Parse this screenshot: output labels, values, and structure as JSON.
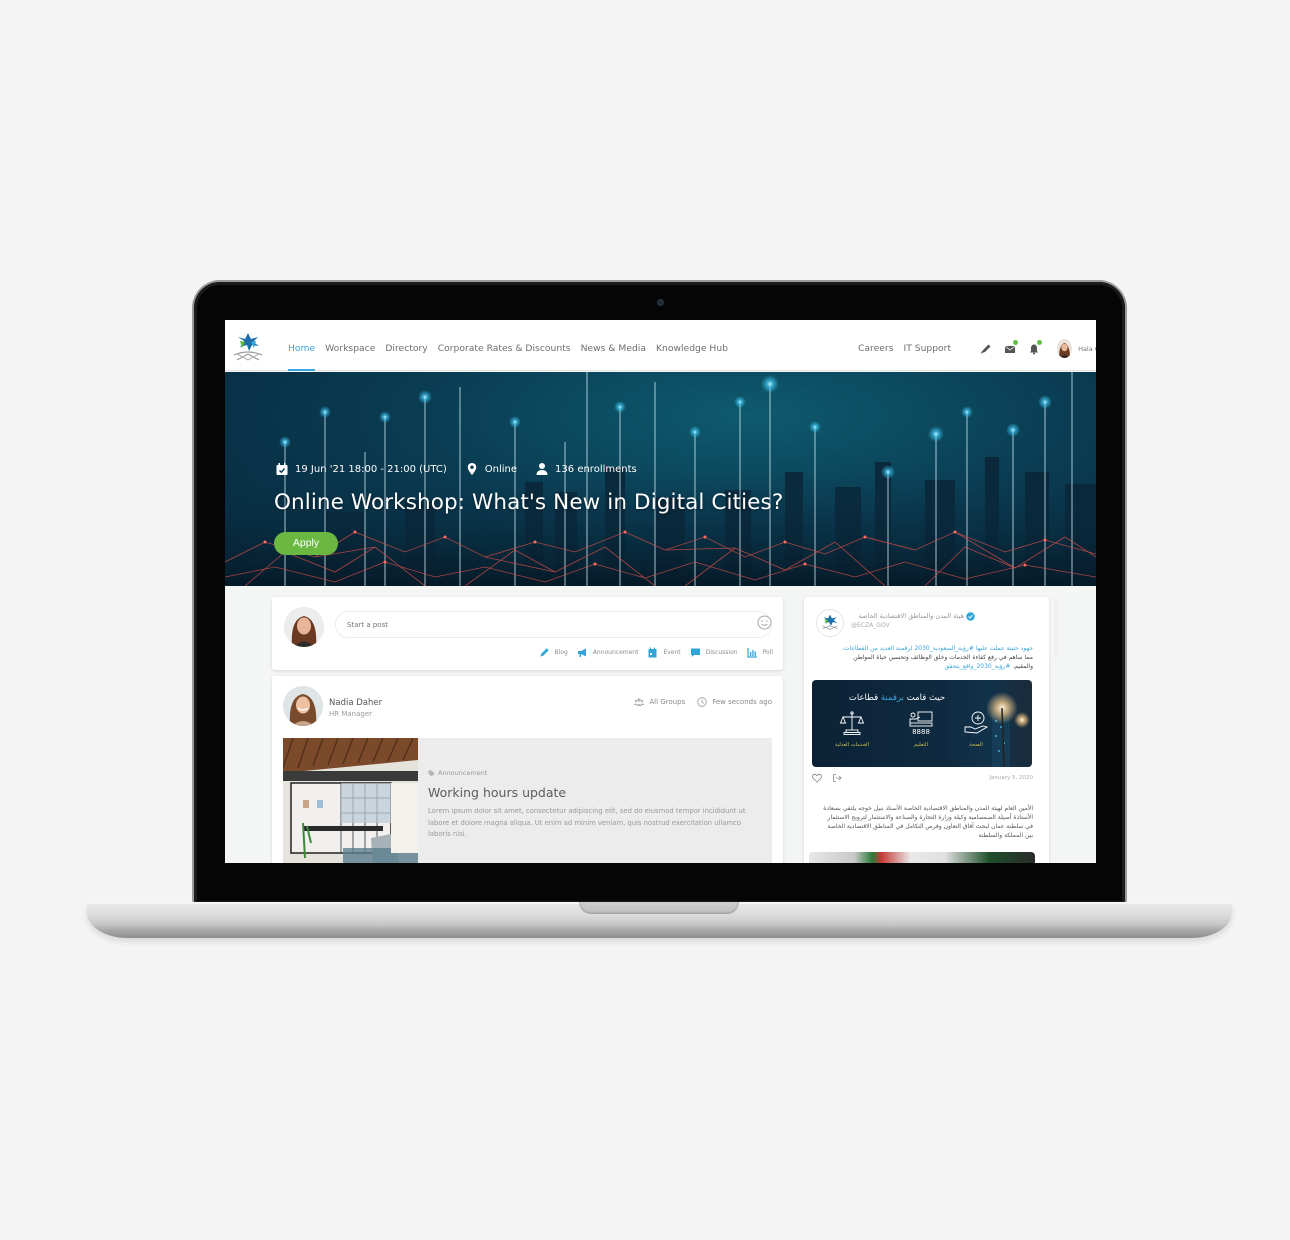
{
  "nav": {
    "links": [
      {
        "label": "Home",
        "active": true
      },
      {
        "label": "Workspace",
        "active": false
      },
      {
        "label": "Directory",
        "active": false
      },
      {
        "label": "Corporate Rates & Discounts",
        "active": false
      },
      {
        "label": "News & Media",
        "active": false
      },
      {
        "label": "Knowledge Hub",
        "active": false
      }
    ],
    "right_links": [
      "Careers",
      "IT Support"
    ],
    "icons": [
      "pencil-icon",
      "mail-icon",
      "bell-icon"
    ],
    "user_name": "Hala Omar",
    "accent_color": "#3aa6dd",
    "notification_dot_color": "#5fc043"
  },
  "hero": {
    "date": "19 Jun '21 18:00 - 21:00 (UTC)",
    "location": "Online",
    "enrollments": "136 enrollments",
    "title": "Online Workshop: What's New in Digital Cities?",
    "apply_label": "Apply",
    "apply_color": "#6ab841"
  },
  "composer": {
    "placeholder": "Start a post",
    "post_types": [
      {
        "icon": "pencil-icon",
        "label": "Blog"
      },
      {
        "icon": "megaphone-icon",
        "label": "Announcement"
      },
      {
        "icon": "calendar-icon",
        "label": "Event"
      },
      {
        "icon": "chat-bubble-icon",
        "label": "Discussion"
      },
      {
        "icon": "bar-chart-icon",
        "label": "Poll"
      }
    ]
  },
  "post": {
    "author": "Nadia Daher",
    "role": "HR Manager",
    "audience": "All Groups",
    "time": "Few seconds ago",
    "tag": "Announcement",
    "title": "Working hours update",
    "text": "Lorem ipsum dolor sit amet, consectetur adipiscing elit, sed do eiusmod tempor incididunt ut labore et dolore magna aliqua. Ut enim ad minim veniam, quis nostrud exercitation ullamco laboris nisi."
  },
  "tweet": {
    "name": "هيئة المدن والمناطق الاقتصادية الخاصة",
    "handle": "@ECZA_GOV",
    "text_line1": "جهود حثيثة عملت عليها #رؤية_السعودية_2030 لرقمنة العديد من القطاعات،",
    "text_line2": "مما ساهم في رفع كفاءة الخدمات وخلق الوظائف وتحسين حياة المواطن",
    "text_line3_plain": "والمقيم.",
    "text_line3_link": "#رؤية_2030_واقع_يتحقق",
    "media_title_pre": "حيث قامت",
    "media_title_hl": "برقمنة",
    "media_title_post": "قطاعات",
    "sectors": [
      "الخدمات العدلية",
      "التعليم",
      "الصحة"
    ],
    "date": "January 5, 2020",
    "text2": "الأمين العام لهيئة المدن والمناطق الاقتصادية الخاصة الأستاذ نبيل خوجه يلتقي بسعادة الأستاذة أصيلة الصمصامية وكيلة وزارة التجارة والصناعة والاستثمار لترويج الاستثمار في سلطنة عمان لبحث آفاق التعاون وفرص التكامل في المناطق الاقتصادية الخاصة بين المملكة والسلطنة"
  }
}
